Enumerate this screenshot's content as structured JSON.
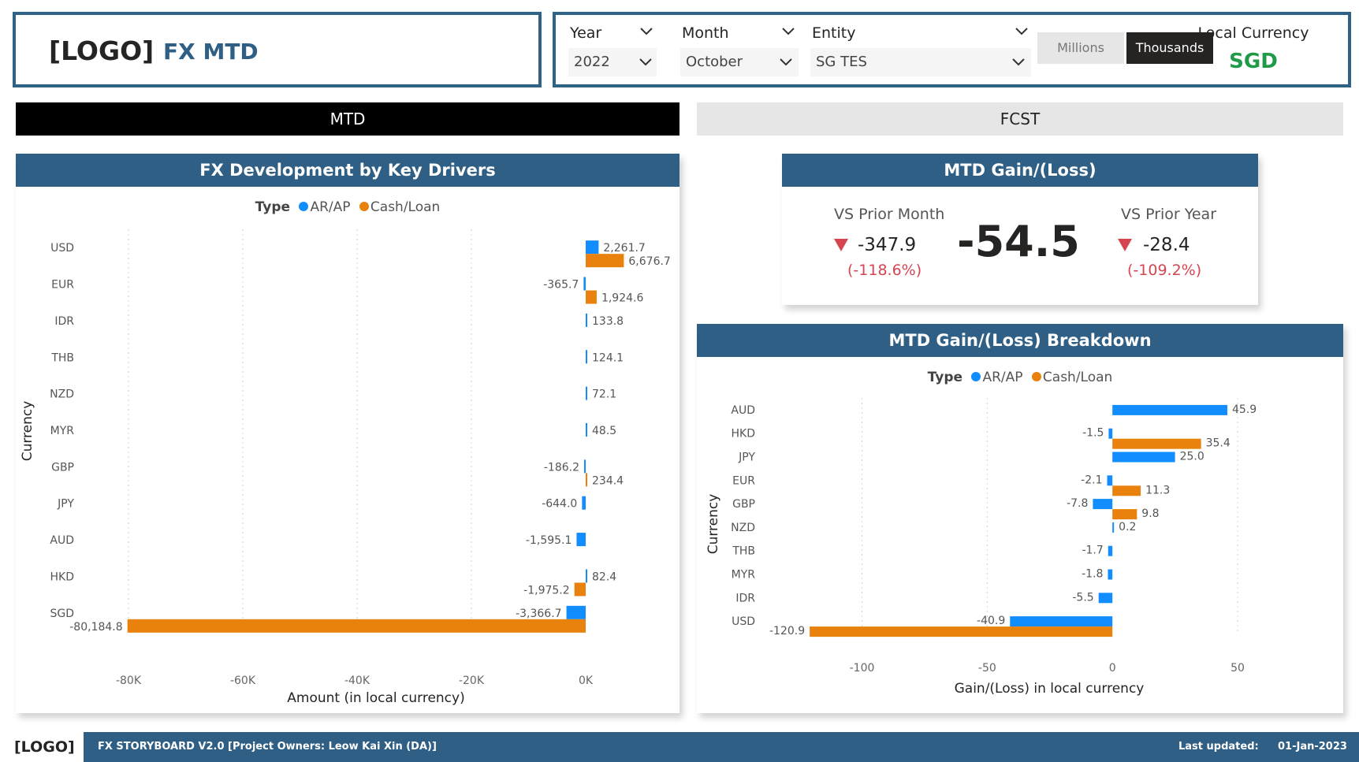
{
  "header": {
    "logo": "[LOGO]",
    "title": "FX MTD"
  },
  "filters": {
    "year": {
      "label": "Year",
      "value": "2022"
    },
    "month": {
      "label": "Month",
      "value": "October"
    },
    "entity": {
      "label": "Entity",
      "value": "SG TES"
    },
    "units": {
      "millions": "Millions",
      "thousands": "Thousands",
      "selected": "Thousands"
    },
    "currency": {
      "label": "Local Currency",
      "value": "SGD",
      "color": "#1F9A48"
    }
  },
  "tabs": {
    "mtd": "MTD",
    "fcst": "FCST",
    "active": "MTD"
  },
  "colors": {
    "arap": "#118DFF",
    "cash": "#E8820C",
    "header": "#2F5F84",
    "negative": "#D64550"
  },
  "kpi": {
    "title": "MTD Gain/(Loss)",
    "main_value": "-54.5",
    "prior_month": {
      "label": "VS Prior Month",
      "value": "-347.9",
      "pct": "(-118.6%)",
      "icon": "down-triangle-icon"
    },
    "prior_year": {
      "label": "VS Prior Year",
      "value": "-28.4",
      "pct": "(-109.2%)",
      "icon": "down-triangle-icon"
    }
  },
  "legend": {
    "title": "Type",
    "arap": "AR/AP",
    "cash": "Cash/Loan"
  },
  "chart_data": [
    {
      "type": "bar",
      "orientation": "horizontal",
      "title": "FX Development by Key Drivers",
      "xlabel": "Amount (in local currency)",
      "ylabel": "Currency",
      "xlim": [
        -80000,
        0
      ],
      "xticks": [
        -80000,
        -60000,
        -40000,
        -20000,
        0
      ],
      "xtick_labels": [
        "-80K",
        "-60K",
        "-40K",
        "-20K",
        "0K"
      ],
      "grid": true,
      "legend": "top",
      "categories": [
        "USD",
        "EUR",
        "IDR",
        "THB",
        "NZD",
        "MYR",
        "GBP",
        "JPY",
        "AUD",
        "HKD",
        "SGD"
      ],
      "series": [
        {
          "name": "AR/AP",
          "values": [
            2261.7,
            -365.7,
            133.8,
            124.1,
            72.1,
            48.5,
            -186.2,
            -644.0,
            -1595.1,
            82.4,
            -3366.7
          ],
          "labels": [
            "2,261.7",
            "-365.7",
            "133.8",
            "124.1",
            "72.1",
            "48.5",
            "-186.2",
            "-644.0",
            "-1,595.1",
            "82.4",
            "-3,366.7"
          ]
        },
        {
          "name": "Cash/Loan",
          "values": [
            6676.7,
            1924.6,
            null,
            null,
            null,
            null,
            234.4,
            null,
            null,
            -1975.2,
            -80184.8
          ],
          "labels": [
            "6,676.7",
            "1,924.6",
            "",
            "",
            "",
            "",
            "234.4",
            "",
            "",
            "-1,975.2",
            "-80,184.8"
          ]
        }
      ]
    },
    {
      "type": "bar",
      "orientation": "horizontal",
      "title": "MTD Gain/(Loss) Breakdown",
      "xlabel": "Gain/(Loss) in local currency",
      "ylabel": "Currency",
      "xlim": [
        -120,
        50
      ],
      "xticks": [
        -100,
        -50,
        0,
        50
      ],
      "xtick_labels": [
        "-100",
        "-50",
        "0",
        "50"
      ],
      "grid": true,
      "legend": "top",
      "categories": [
        "AUD",
        "HKD",
        "JPY",
        "EUR",
        "GBP",
        "NZD",
        "THB",
        "MYR",
        "IDR",
        "USD"
      ],
      "series": [
        {
          "name": "AR/AP",
          "values": [
            45.9,
            -1.5,
            25.0,
            -2.1,
            -7.8,
            0.2,
            -1.7,
            -1.8,
            -5.5,
            -40.9
          ],
          "labels": [
            "45.9",
            "-1.5",
            "25.0",
            "-2.1",
            "-7.8",
            "0.2",
            "-1.7",
            "-1.8",
            "-5.5",
            "-40.9"
          ]
        },
        {
          "name": "Cash/Loan",
          "values": [
            null,
            35.4,
            null,
            11.3,
            9.8,
            null,
            null,
            null,
            null,
            -120.9
          ],
          "labels": [
            "",
            "35.4",
            "",
            "11.3",
            "9.8",
            "",
            "",
            "",
            "",
            "-120.9"
          ]
        }
      ]
    }
  ],
  "footer": {
    "logo": "[LOGO]",
    "text": "FX STORYBOARD V2.0  [Project Owners: Leow Kai Xin (DA)]",
    "updated_label": "Last updated:",
    "updated_value": "01-Jan-2023"
  }
}
